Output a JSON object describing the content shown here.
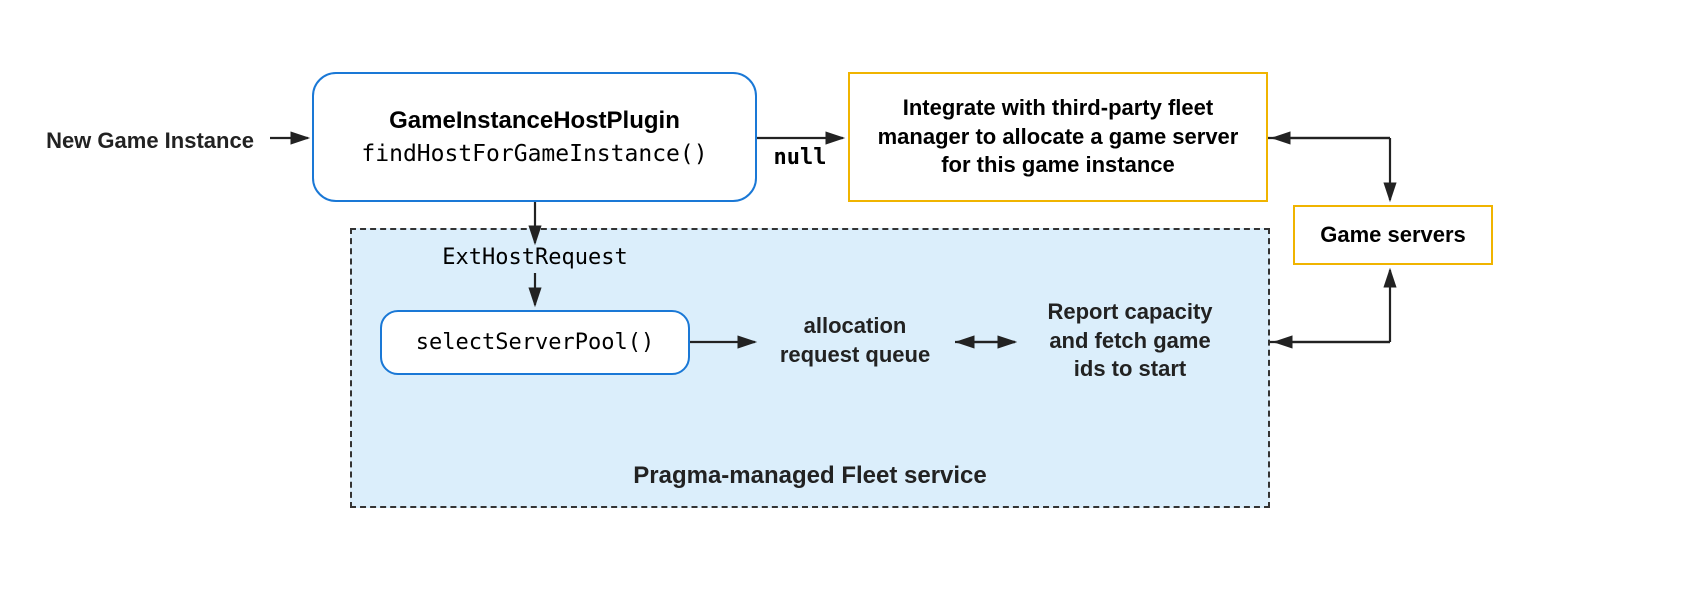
{
  "nodes": {
    "new_game_instance": "New Game Instance",
    "plugin_title": "GameInstanceHostPlugin",
    "plugin_method": "findHostForGameInstance()",
    "null_label": "null",
    "third_party": "Integrate with third-party fleet manager to allocate a game server for this game instance",
    "game_servers": "Game servers",
    "ext_host_request": "ExtHostRequest",
    "select_server_pool": "selectServerPool()",
    "allocation_queue_l1": "allocation",
    "allocation_queue_l2": "request queue",
    "report_capacity_l1": "Report capacity",
    "report_capacity_l2": "and fetch game",
    "report_capacity_l3": "ids to start",
    "fleet_service_title": "Pragma-managed Fleet service"
  }
}
